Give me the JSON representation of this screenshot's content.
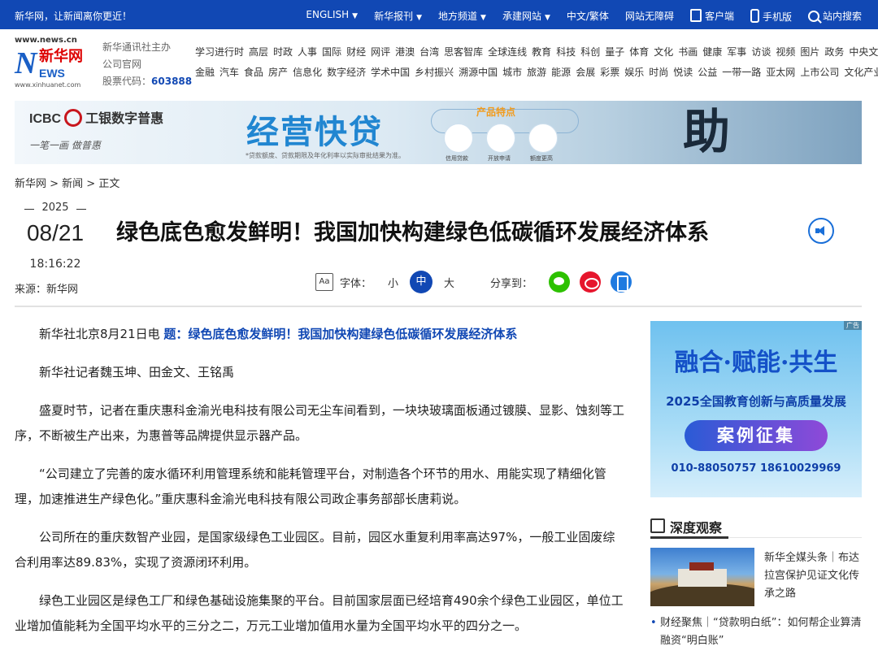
{
  "topbar": {
    "slogan": "新华网，让新闻离你更近！",
    "nav": [
      "ENGLISH",
      "新华报刊",
      "地方频道",
      "承建网站",
      "中文/繁体",
      "网站无障碍",
      "客户端",
      "手机版",
      "站内搜索"
    ]
  },
  "logo": {
    "url": "www.news.cn",
    "mark": "N",
    "name": "新华网",
    "en": "EWS",
    "url2": "www.xinhuanet.com"
  },
  "org": {
    "line1": "新华通讯社主办",
    "line2": "公司官网",
    "stock_label": "股票代码：",
    "stock_code": "603888"
  },
  "cats": {
    "row1": [
      "学习进行时",
      "高层",
      "时政",
      "人事",
      "国际",
      "财经",
      "网评",
      "港澳",
      "台湾",
      "思客智库",
      "全球连线",
      "教育",
      "科技",
      "科创",
      "量子",
      "体育",
      "文化",
      "书画",
      "健康",
      "军事",
      "访谈",
      "视频",
      "图片",
      "政务",
      "中央文件"
    ],
    "row2": [
      "金融",
      "汽车",
      "食品",
      "房产",
      "信息化",
      "数字经济",
      "学术中国",
      "乡村振兴",
      "溯源中国",
      "城市",
      "旅游",
      "能源",
      "会展",
      "彩票",
      "娱乐",
      "时尚",
      "悦读",
      "公益",
      "一带一路",
      "亚太网",
      "上市公司",
      "文化产业"
    ]
  },
  "banner": {
    "icbc": "ICBC",
    "icbc_cn": "工银数字普惠",
    "brand": "一笔一画 做普惠",
    "headline": "经营快贷",
    "fine": "*贷款额度、贷款期限及年化利率以实际审批结果为准。",
    "features_title": "产品特点",
    "features": [
      "信用贷款",
      "开放申请",
      "额度更高"
    ],
    "slogan": "助"
  },
  "breadcrumb": "新华网 > 新闻 > 正文",
  "date": {
    "year": "2025",
    "md": "08/21",
    "time": "18:16:22"
  },
  "source": "来源：新华网",
  "title": "绿色底色愈发鲜明！我国加快构建绿色低碳循环发展经济体系",
  "tools": {
    "font_label": "字体：",
    "sizes": [
      "小",
      "中",
      "大"
    ],
    "share_label": "分享到："
  },
  "article": {
    "lead_prefix": "新华社北京8月21日电 ",
    "lead_title": "题：绿色底色愈发鲜明！我国加快构建绿色低碳循环发展经济体系",
    "byline": "新华社记者魏玉坤、田金文、王铭禹",
    "p1": "盛夏时节，记者在重庆惠科金渝光电科技有限公司无尘车间看到，一块块玻璃面板通过镀膜、显影、蚀刻等工序，不断被生产出来，为惠普等品牌提供显示器产品。",
    "p2": "“公司建立了完善的废水循环利用管理系统和能耗管理平台，对制造各个环节的用水、用能实现了精细化管理，加速推进生产绿色化。”重庆惠科金渝光电科技有限公司政企事务部部长唐莉说。",
    "p3": "公司所在的重庆数智产业园，是国家级绿色工业园区。目前，园区水重复利用率高达97%，一般工业固废综合利用率达89.83%，实现了资源闭环利用。",
    "p4": "绿色工业园区是绿色工厂和绿色基础设施集聚的平台。目前国家层面已经培育490余个绿色工业园区，单位工业增加值能耗为全国平均水平的三分之二，万元工业增加值用水量为全国平均水平的四分之一。"
  },
  "side_ad": {
    "tag": "广告",
    "t1": "融合·赋能·共生",
    "t2": "2025全国教育创新与高质量发展",
    "btn": "案例征集",
    "phones": "010-88050757  18610029969"
  },
  "deep": {
    "heading": "深度观察",
    "item1": "新华全媒头条｜布达拉宫保护见证文化传承之路",
    "item2": "财经聚焦｜“贷款明白纸”：如何帮企业算清融资“明白账”"
  }
}
